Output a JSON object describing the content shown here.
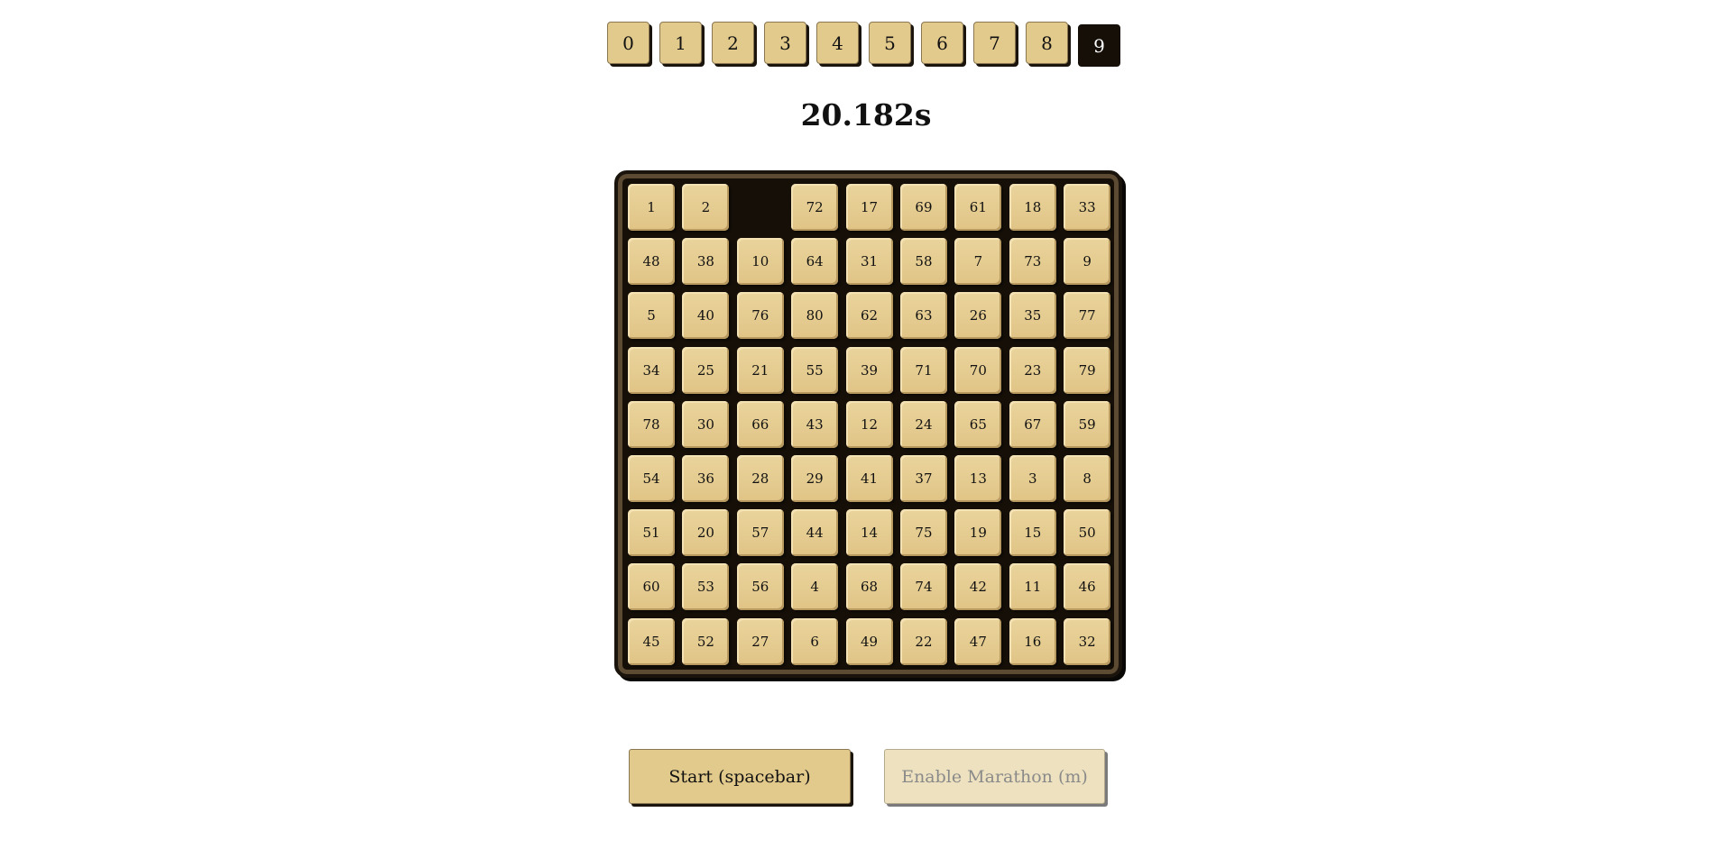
{
  "size_selector": {
    "options": [
      "0",
      "1",
      "2",
      "3",
      "4",
      "5",
      "6",
      "7",
      "8",
      "9"
    ],
    "selected": "9"
  },
  "timer": "20.182s",
  "board": {
    "size": 9,
    "tiles": [
      "1",
      "2",
      "",
      "72",
      "17",
      "69",
      "61",
      "18",
      "33",
      "48",
      "38",
      "10",
      "64",
      "31",
      "58",
      "7",
      "73",
      "9",
      "5",
      "40",
      "76",
      "80",
      "62",
      "63",
      "26",
      "35",
      "77",
      "34",
      "25",
      "21",
      "55",
      "39",
      "71",
      "70",
      "23",
      "79",
      "78",
      "30",
      "66",
      "43",
      "12",
      "24",
      "65",
      "67",
      "59",
      "54",
      "36",
      "28",
      "29",
      "41",
      "37",
      "13",
      "3",
      "8",
      "51",
      "20",
      "57",
      "44",
      "14",
      "75",
      "19",
      "15",
      "50",
      "60",
      "53",
      "56",
      "4",
      "68",
      "74",
      "42",
      "11",
      "46",
      "45",
      "52",
      "27",
      "6",
      "49",
      "22",
      "47",
      "16",
      "32"
    ]
  },
  "controls": {
    "start_label": "Start (spacebar)",
    "marathon_label": "Enable Marathon (m)"
  },
  "colors": {
    "tile": "#e2c98c",
    "board": "#150f08",
    "selected_size": "#150f08"
  }
}
